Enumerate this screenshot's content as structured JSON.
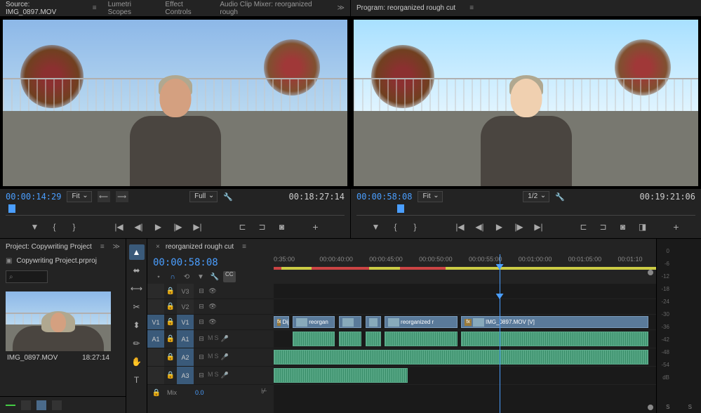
{
  "source": {
    "tab": "Source: IMG_0897.MOV",
    "tabs": [
      "Lumetri Scopes",
      "Effect Controls",
      "Audio Clip Mixer: reorganized rough"
    ],
    "tc_left": "00:00:14:29",
    "tc_right": "00:18:27:14",
    "fit": "Fit",
    "resolution": "Full"
  },
  "program": {
    "tab": "Program: reorganized rough cut",
    "tc_left": "00:00:58:08",
    "tc_right": "00:19:21:06",
    "fit": "Fit",
    "resolution": "1/2"
  },
  "transport": {
    "mark_in": "{",
    "mark_out": "}",
    "add_marker": "▼",
    "goto_in": "|◀",
    "step_back": "◀|",
    "play": "▶",
    "step_fwd": "|▶",
    "goto_out": "▶|",
    "plus": "+"
  },
  "project": {
    "tab": "Project: Copywriting Project",
    "file": "Copywriting Project.prproj",
    "search_placeholder": "⌕",
    "thumb_name": "IMG_0897.MOV",
    "thumb_dur": "18:27:14"
  },
  "tools": {
    "selection": "▲",
    "track_select": "⬌",
    "ripple": "⟷",
    "razor": "✂",
    "slip": "⬍",
    "pen": "✏",
    "hand": "✋",
    "type": "T"
  },
  "timeline": {
    "sequence": "reorganized rough cut",
    "timecode": "00:00:58:08",
    "ruler": [
      "0:35:00",
      "00:00:40:00",
      "00:00:45:00",
      "00:00:50:00",
      "00:00:55:00",
      "00:01:00:00",
      "00:01:05:00",
      "00:01:10"
    ],
    "tracks": {
      "v3": "V3",
      "v2": "V2",
      "v1": "V1",
      "v1_src": "V1",
      "a1": "A1",
      "a1_src": "A1",
      "a2": "A2",
      "a3": "A3"
    },
    "mix": "Mix",
    "mix_val": "0.0",
    "clips": {
      "dij": "Dij",
      "reorgan": "reorgan",
      "reorganized_r": "reorganized r",
      "img0897": "IMG_0897.MOV [V]"
    },
    "track_btns": {
      "m": "M",
      "s": "S",
      "eye": "👁",
      "sync": "⊟"
    },
    "cc": "CC"
  },
  "meters": {
    "db": [
      "0",
      "-6",
      "-12",
      "-18",
      "-24",
      "-30",
      "-36",
      "-42",
      "-48",
      "-54",
      "dB"
    ],
    "solo": "S"
  }
}
